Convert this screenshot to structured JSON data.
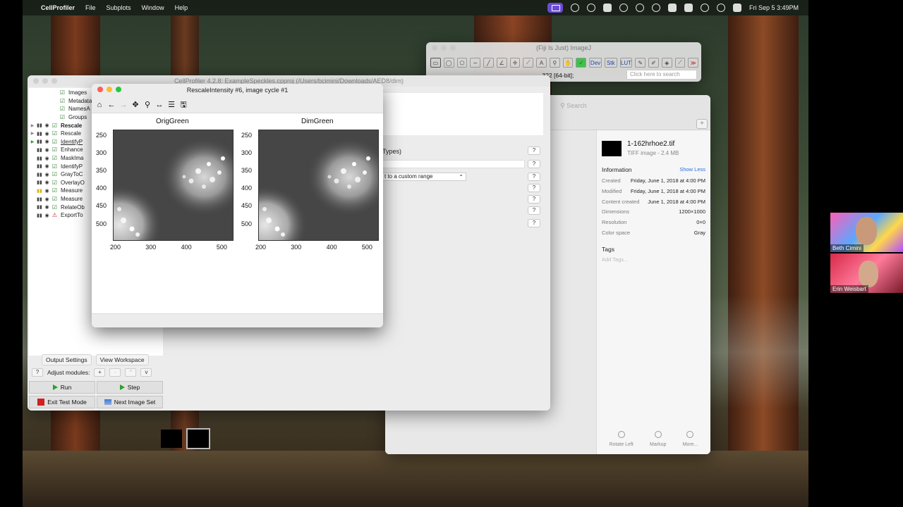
{
  "menubar": {
    "app": "CellProfiler",
    "items": [
      "File",
      "Subplots",
      "Window",
      "Help"
    ],
    "clock": "Fri Sep 5  3:49PM"
  },
  "fiji": {
    "title": "(Fiji Is Just) ImageJ",
    "tools": [
      "rect",
      "oval",
      "polygon",
      "freehand",
      "line",
      "angle",
      "point",
      "wand",
      "text",
      "zoom",
      "hand",
      "color",
      "Dev",
      "Stk",
      "LUT",
      "pencil",
      "brush",
      "flood",
      "picker",
      "more"
    ],
    "status": "…322 [64-bit];",
    "search_placeholder": "Click here to search"
  },
  "cellprofiler": {
    "title": "CellProfiler 4.2.8: ExampleSpeckles.cpproj (/Users/bcimini/Downloads/AED8/dim)",
    "input_modules": [
      "Images",
      "Metadata",
      "NamesA",
      "Groups"
    ],
    "modules": [
      {
        "label": "Rescale",
        "style": "bold",
        "arrow": "▶",
        "arrow_color": "gray",
        "pause": "▮▮",
        "pause_color": "dark",
        "check": "☑"
      },
      {
        "label": "Rescale",
        "style": "",
        "arrow": "▶",
        "arrow_color": "gray",
        "pause": "▮▮",
        "pause_color": "dark",
        "check": "☑"
      },
      {
        "label": "IdentifyP",
        "style": "ul",
        "arrow": "▶",
        "arrow_color": "green",
        "pause": "▮▮",
        "pause_color": "dark",
        "check": "☑"
      },
      {
        "label": "Enhance",
        "style": "",
        "arrow": "",
        "arrow_color": "gray",
        "pause": "▮▮",
        "pause_color": "dark",
        "check": "☑"
      },
      {
        "label": "MaskIma",
        "style": "",
        "arrow": "",
        "arrow_color": "gray",
        "pause": "▮▮",
        "pause_color": "dark",
        "check": "☑"
      },
      {
        "label": "IdentifyP",
        "style": "",
        "arrow": "",
        "arrow_color": "gray",
        "pause": "▮▮",
        "pause_color": "dark",
        "check": "☑"
      },
      {
        "label": "GrayToC",
        "style": "",
        "arrow": "",
        "arrow_color": "gray",
        "pause": "▮▮",
        "pause_color": "dark",
        "check": "☑"
      },
      {
        "label": "OverlayO",
        "style": "",
        "arrow": "",
        "arrow_color": "gray",
        "pause": "▮▮",
        "pause_color": "dark",
        "check": "☑"
      },
      {
        "label": "Measure",
        "style": "",
        "arrow": "",
        "arrow_color": "gray",
        "pause": "▮▮",
        "pause_color": "yellow",
        "check": "☑"
      },
      {
        "label": "Measure",
        "style": "",
        "arrow": "",
        "arrow_color": "gray",
        "pause": "▮▮",
        "pause_color": "dark",
        "check": "☑"
      },
      {
        "label": "RelateOb",
        "style": "",
        "arrow": "",
        "arrow_color": "gray",
        "pause": "▮▮",
        "pause_color": "dark",
        "check": "☑"
      },
      {
        "label": "ExportTo",
        "style": "",
        "arrow": "",
        "arrow_color": "gray",
        "pause": "▮▮",
        "pause_color": "dark",
        "check": "⚠"
      }
    ],
    "types_text": "Types)",
    "select_value": "t to a custom range",
    "help_label": "?",
    "output_settings": "Output Settings",
    "view_workspace": "View Workspace",
    "adjust_label": "Adjust modules:",
    "adjust_buttons": [
      "+",
      "-",
      "^",
      "v"
    ],
    "run": "Run",
    "step": "Step",
    "exit_test": "Exit Test Mode",
    "next_image": "Next Image Set"
  },
  "figure": {
    "title": "RescaleIntensity #6, image cycle #1",
    "toolbar": [
      "home",
      "back",
      "forward",
      "pan",
      "zoom",
      "subplots",
      "configure",
      "save"
    ],
    "plots": [
      {
        "title": "OrigGreen"
      },
      {
        "title": "DimGreen"
      }
    ],
    "y_ticks": [
      "250",
      "300",
      "350",
      "400",
      "450",
      "500"
    ],
    "x_ticks": [
      "200",
      "300",
      "400",
      "500"
    ]
  },
  "preview": {
    "search_placeholder": "Search",
    "file_name": "1-162hrhoe2.tif",
    "file_sub": "TIFF image - 2.4 MB",
    "information_label": "Information",
    "show_less": "Show Less",
    "info_rows": [
      {
        "k": "Created",
        "v": "Friday, June 1, 2018 at 4:00 PM"
      },
      {
        "k": "Modified",
        "v": "Friday, June 1, 2018 at 4:00 PM"
      },
      {
        "k": "Content created",
        "v": "June 1, 2018 at 4:00 PM"
      },
      {
        "k": "Dimensions",
        "v": "1200×1000"
      },
      {
        "k": "Resolution",
        "v": "0×0"
      },
      {
        "k": "Color space",
        "v": "Gray"
      }
    ],
    "tags_label": "Tags",
    "add_tags": "Add Tags...",
    "buttons": [
      "Rotate Left",
      "Markup",
      "More..."
    ]
  },
  "participants": [
    {
      "name": "Beth Cimini"
    },
    {
      "name": "Erin Weisbart"
    }
  ],
  "colors": {
    "accent_green": "#2aa02a",
    "link_blue": "#2a6fe0",
    "stop_red": "#d02020"
  }
}
